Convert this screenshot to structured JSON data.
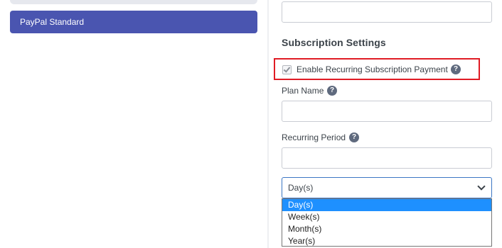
{
  "sidebar": {
    "gateway_items": [
      {
        "label": "PayPal Standard"
      }
    ]
  },
  "form": {
    "top_input_value": "",
    "subscription_heading": "Subscription Settings",
    "recurring_checkbox": {
      "label": "Enable Recurring Subscription Payment",
      "checked": true
    },
    "plan_name": {
      "label": "Plan Name",
      "value": ""
    },
    "recurring_period": {
      "label": "Recurring Period",
      "value": "",
      "select_value": "Day(s)",
      "options": [
        "Day(s)",
        "Week(s)",
        "Month(s)",
        "Year(s)"
      ],
      "highlighted_option": "Day(s)"
    },
    "help_glyph": "?",
    "colors": {
      "accent": "#4a55b0",
      "highlight_border": "#e01b24",
      "option_highlight": "#1e90ff",
      "help_icon": "#5f6a7e"
    },
    "icons": [
      "question-help-icon",
      "checkmark-icon",
      "chevron-down-icon"
    ]
  }
}
